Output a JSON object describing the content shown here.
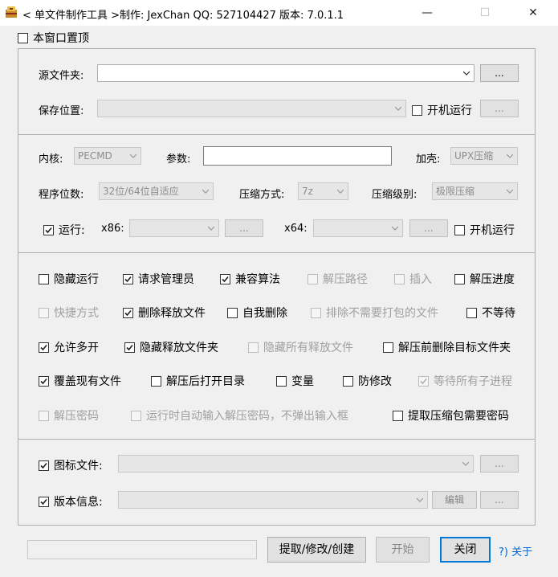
{
  "window": {
    "title": "< 单文件制作工具 >制作: JexChan  QQ: 527104427  版本: 7.0.1.1",
    "minimize": "—",
    "maximize": "☐",
    "close": "✕"
  },
  "topmost": {
    "label": "本窗口置顶",
    "checked": false
  },
  "source": {
    "label": "源文件夹:",
    "value": "",
    "browse": "..."
  },
  "save": {
    "label": "保存位置:",
    "value": "",
    "boot_run": "开机运行",
    "boot_run_checked": false,
    "browse": "..."
  },
  "kernel": {
    "label": "内核:",
    "value": "PECMD"
  },
  "params": {
    "label": "参数:",
    "value": ""
  },
  "shell": {
    "label": "加壳:",
    "value": "UPX压缩"
  },
  "bits": {
    "label": "程序位数:",
    "value": "32位/64位自适应"
  },
  "compress_method": {
    "label": "压缩方式:",
    "value": "7z"
  },
  "compress_level": {
    "label": "压缩级别:",
    "value": "极限压缩"
  },
  "run": {
    "label": "运行:",
    "checked": true,
    "x86_label": "x86:",
    "x64_label": "x64:",
    "browse": "...",
    "boot_run": "开机运行",
    "boot_run_checked": false
  },
  "options": {
    "hide_run": {
      "label": "隐藏运行",
      "checked": false
    },
    "admin": {
      "label": "请求管理员",
      "checked": true
    },
    "compat": {
      "label": "兼容算法",
      "checked": true
    },
    "extract_path": {
      "label": "解压路径",
      "checked": false
    },
    "insert": {
      "label": "插入",
      "checked": false
    },
    "extract_progress": {
      "label": "解压进度",
      "checked": false
    },
    "shortcut": {
      "label": "快捷方式",
      "checked": false
    },
    "delete_released": {
      "label": "删除释放文件",
      "checked": true
    },
    "self_delete": {
      "label": "自我删除",
      "checked": false
    },
    "exclude_unneeded": {
      "label": "排除不需要打包的文件",
      "checked": false
    },
    "no_wait": {
      "label": "不等待",
      "checked": false
    },
    "allow_multi": {
      "label": "允许多开",
      "checked": true
    },
    "hide_release_folder": {
      "label": "隐藏释放文件夹",
      "checked": true
    },
    "hide_all_released": {
      "label": "隐藏所有释放文件",
      "checked": false
    },
    "delete_target_before": {
      "label": "解压前删除目标文件夹",
      "checked": false
    },
    "overwrite": {
      "label": "覆盖现有文件",
      "checked": true
    },
    "open_dir_after": {
      "label": "解压后打开目录",
      "checked": false
    },
    "variable": {
      "label": "变量",
      "checked": false
    },
    "anti_modify": {
      "label": "防修改",
      "checked": false
    },
    "wait_all_children": {
      "label": "等待所有子进程",
      "checked": true
    },
    "extract_password": {
      "label": "解压密码",
      "checked": false
    },
    "auto_password": {
      "label": "运行时自动输入解压密码，不弹出输入框",
      "checked": false
    },
    "extract_need_password": {
      "label": "提取压缩包需要密码",
      "checked": false
    }
  },
  "icon_file": {
    "label": "图标文件:",
    "checked": true,
    "browse": "..."
  },
  "version_info": {
    "label": "版本信息:",
    "checked": true,
    "edit": "编辑",
    "browse": "..."
  },
  "bottom": {
    "extract_modify_create": "提取/修改/创建",
    "start": "开始",
    "close": "关闭",
    "about": "?) 关于"
  }
}
